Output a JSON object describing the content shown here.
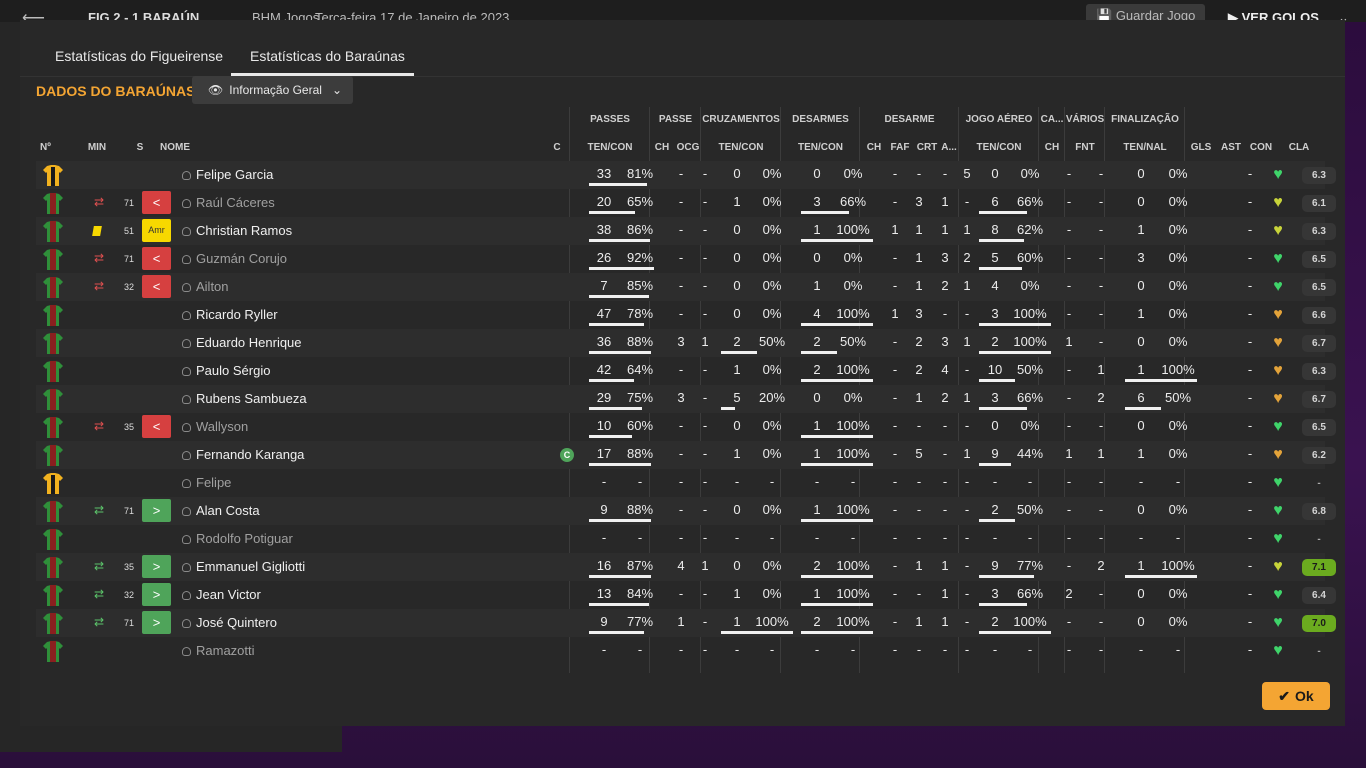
{
  "topbar": {
    "score": "FIG  2 - 1  BARAÚN",
    "org": "BHM Jogos",
    "date": "Terça-feira 17 de Janeiro de 2023",
    "save_label": "Guardar Jogo",
    "goals_label": "VER GOLOS"
  },
  "tabs": [
    "Estatísticas do Figueirense",
    "Estatísticas do Baraúnas"
  ],
  "title": "DADOS DO BARAÚNAS",
  "view_dropdown": "Informação Geral",
  "groups": {
    "passes": "PASSES",
    "passe": "PASSE",
    "cruz": "CRUZAMENTOS",
    "desarmes": "DESARMES",
    "desarme": "DESARME",
    "aereo": "JOGO AÉREO",
    "ca": "CA...",
    "varios": "VÁRIOS",
    "finalizacao": "FINALIZAÇÃO"
  },
  "headers": {
    "num": "Nº",
    "min": "MIN",
    "s": "S",
    "nome": "NOME",
    "c": "C",
    "passes": "TEN/CON",
    "passe_ch": "CH",
    "passe_ocg": "OCG",
    "cruz": "TEN/CON",
    "desarmes": "TEN/CON",
    "des_ch": "CH",
    "des_faf": "FAF",
    "des_crt": "CRT",
    "des_a": "A...",
    "aereo": "TEN/CON",
    "ca_ch": "CH",
    "var_fnt": "FNT",
    "fin": "TEN/NAL",
    "gls": "GLS",
    "ast": "AST",
    "con": "CON",
    "cla": "CLA"
  },
  "ok_label": "Ok",
  "colors": {
    "accent": "#f4a533",
    "cla_green": "#6bab1f",
    "red_card": "#d64040"
  },
  "players": [
    {
      "name": "Felipe Garcia",
      "gk": true,
      "min": "",
      "sub": "",
      "s": "",
      "dim": false,
      "captain": false,
      "p": [
        "33",
        "81%"
      ],
      "pp": [
        "-",
        "-"
      ],
      "cr": [
        "0",
        "0%"
      ],
      "de": [
        "0",
        "0%"
      ],
      "d2": [
        "-",
        "-",
        "-",
        "5"
      ],
      "ae": [
        "0",
        "0%"
      ],
      "ca": "-",
      "fnt": "-",
      "fi": [
        "0",
        "0%"
      ],
      "gls": "",
      "ast": "-",
      "heart": "#3fd46a",
      "cla": "6.3",
      "clastyle": "gray",
      "bars": {
        "p": 0.81,
        "cr": 0,
        "de": 0,
        "ae": 0,
        "fi": 0
      }
    },
    {
      "name": "Raúl Cáceres",
      "gk": false,
      "min": "71",
      "sub": "out",
      "s": "red",
      "dim": true,
      "captain": false,
      "p": [
        "20",
        "65%"
      ],
      "pp": [
        "-",
        "-"
      ],
      "cr": [
        "1",
        "0%"
      ],
      "de": [
        "3",
        "66%"
      ],
      "d2": [
        "-",
        "3",
        "1",
        "-"
      ],
      "ae": [
        "6",
        "66%"
      ],
      "ca": "-",
      "fnt": "-",
      "fi": [
        "0",
        "0%"
      ],
      "gls": "",
      "ast": "-",
      "heart": "#c8d43a",
      "cla": "6.1",
      "clastyle": "gray",
      "bars": {
        "p": 0.65,
        "cr": 0,
        "de": 0.66,
        "ae": 0.66,
        "fi": 0
      }
    },
    {
      "name": "Christian Ramos",
      "gk": false,
      "min": "51",
      "sub": "yellow",
      "s": "amr",
      "dim": false,
      "captain": false,
      "p": [
        "38",
        "86%"
      ],
      "pp": [
        "-",
        "-"
      ],
      "cr": [
        "0",
        "0%"
      ],
      "de": [
        "1",
        "100%"
      ],
      "d2": [
        "1",
        "1",
        "1",
        "1"
      ],
      "ae": [
        "8",
        "62%"
      ],
      "ca": "-",
      "fnt": "-",
      "fi": [
        "1",
        "0%"
      ],
      "gls": "",
      "ast": "-",
      "heart": "#c8d43a",
      "cla": "6.3",
      "clastyle": "gray",
      "bars": {
        "p": 0.86,
        "cr": 0,
        "de": 1,
        "ae": 0.62,
        "fi": 0
      }
    },
    {
      "name": "Guzmán Corujo",
      "gk": false,
      "min": "71",
      "sub": "out",
      "s": "red",
      "dim": true,
      "captain": false,
      "p": [
        "26",
        "92%"
      ],
      "pp": [
        "-",
        "-"
      ],
      "cr": [
        "0",
        "0%"
      ],
      "de": [
        "0",
        "0%"
      ],
      "d2": [
        "-",
        "1",
        "3",
        "2"
      ],
      "ae": [
        "5",
        "60%"
      ],
      "ca": "-",
      "fnt": "-",
      "fi": [
        "3",
        "0%"
      ],
      "gls": "",
      "ast": "-",
      "heart": "#3fd46a",
      "cla": "6.5",
      "clastyle": "gray",
      "bars": {
        "p": 0.92,
        "cr": 0,
        "de": 0,
        "ae": 0.6,
        "fi": 0
      }
    },
    {
      "name": "Ailton",
      "gk": false,
      "min": "32",
      "sub": "out",
      "s": "red",
      "dim": true,
      "captain": false,
      "p": [
        "7",
        "85%"
      ],
      "pp": [
        "-",
        "-"
      ],
      "cr": [
        "0",
        "0%"
      ],
      "de": [
        "1",
        "0%"
      ],
      "d2": [
        "-",
        "1",
        "2",
        "1"
      ],
      "ae": [
        "4",
        "0%"
      ],
      "ca": "-",
      "fnt": "-",
      "fi": [
        "0",
        "0%"
      ],
      "gls": "",
      "ast": "-",
      "heart": "#3fd46a",
      "cla": "6.5",
      "clastyle": "gray",
      "bars": {
        "p": 0.85,
        "cr": 0,
        "de": 0,
        "ae": 0,
        "fi": 0
      }
    },
    {
      "name": "Ricardo Ryller",
      "gk": false,
      "min": "",
      "sub": "",
      "s": "",
      "dim": false,
      "captain": false,
      "p": [
        "47",
        "78%"
      ],
      "pp": [
        "-",
        "-"
      ],
      "cr": [
        "0",
        "0%"
      ],
      "de": [
        "4",
        "100%"
      ],
      "d2": [
        "1",
        "3",
        "-",
        "-"
      ],
      "ae": [
        "3",
        "100%"
      ],
      "ca": "-",
      "fnt": "-",
      "fi": [
        "1",
        "0%"
      ],
      "gls": "",
      "ast": "-",
      "heart": "#e3a33a",
      "cla": "6.6",
      "clastyle": "gray",
      "bars": {
        "p": 0.78,
        "cr": 0,
        "de": 1,
        "ae": 1,
        "fi": 0
      }
    },
    {
      "name": "Eduardo Henrique",
      "gk": false,
      "min": "",
      "sub": "",
      "s": "",
      "dim": false,
      "captain": false,
      "p": [
        "36",
        "88%"
      ],
      "pp": [
        "3",
        "1"
      ],
      "cr": [
        "2",
        "50%"
      ],
      "de": [
        "2",
        "50%"
      ],
      "d2": [
        "-",
        "2",
        "3",
        "1"
      ],
      "ae": [
        "2",
        "100%"
      ],
      "ca": "1",
      "fnt": "-",
      "fi": [
        "0",
        "0%"
      ],
      "gls": "",
      "ast": "-",
      "heart": "#e3a33a",
      "cla": "6.7",
      "clastyle": "gray",
      "bars": {
        "p": 0.88,
        "cr": 0.5,
        "de": 0.5,
        "ae": 1,
        "fi": 0
      }
    },
    {
      "name": "Paulo Sérgio",
      "gk": false,
      "min": "",
      "sub": "",
      "s": "",
      "dim": false,
      "captain": false,
      "p": [
        "42",
        "64%"
      ],
      "pp": [
        "-",
        "-"
      ],
      "cr": [
        "1",
        "0%"
      ],
      "de": [
        "2",
        "100%"
      ],
      "d2": [
        "-",
        "2",
        "4",
        "-"
      ],
      "ae": [
        "10",
        "50%"
      ],
      "ca": "-",
      "fnt": "1",
      "fi": [
        "1",
        "100%"
      ],
      "gls": "",
      "ast": "-",
      "heart": "#e3a33a",
      "cla": "6.3",
      "clastyle": "gray",
      "bars": {
        "p": 0.64,
        "cr": 0,
        "de": 1,
        "ae": 0.5,
        "fi": 1
      }
    },
    {
      "name": "Rubens Sambueza",
      "gk": false,
      "min": "",
      "sub": "",
      "s": "",
      "dim": false,
      "captain": false,
      "p": [
        "29",
        "75%"
      ],
      "pp": [
        "3",
        "-"
      ],
      "cr": [
        "5",
        "20%"
      ],
      "de": [
        "0",
        "0%"
      ],
      "d2": [
        "-",
        "1",
        "2",
        "1"
      ],
      "ae": [
        "3",
        "66%"
      ],
      "ca": "-",
      "fnt": "2",
      "fi": [
        "6",
        "50%"
      ],
      "gls": "",
      "ast": "-",
      "heart": "#e3a33a",
      "cla": "6.7",
      "clastyle": "gray",
      "bars": {
        "p": 0.75,
        "cr": 0.2,
        "de": 0,
        "ae": 0.66,
        "fi": 0.5
      }
    },
    {
      "name": "Wallyson",
      "gk": false,
      "min": "35",
      "sub": "out",
      "s": "red",
      "dim": true,
      "captain": false,
      "p": [
        "10",
        "60%"
      ],
      "pp": [
        "-",
        "-"
      ],
      "cr": [
        "0",
        "0%"
      ],
      "de": [
        "1",
        "100%"
      ],
      "d2": [
        "-",
        "-",
        "-",
        "-"
      ],
      "ae": [
        "0",
        "0%"
      ],
      "ca": "-",
      "fnt": "-",
      "fi": [
        "0",
        "0%"
      ],
      "gls": "",
      "ast": "-",
      "heart": "#3fd46a",
      "cla": "6.5",
      "clastyle": "gray",
      "bars": {
        "p": 0.6,
        "cr": 0,
        "de": 1,
        "ae": 0,
        "fi": 0
      }
    },
    {
      "name": "Fernando Karanga",
      "gk": false,
      "min": "",
      "sub": "",
      "s": "",
      "dim": false,
      "captain": true,
      "p": [
        "17",
        "88%"
      ],
      "pp": [
        "-",
        "-"
      ],
      "cr": [
        "1",
        "0%"
      ],
      "de": [
        "1",
        "100%"
      ],
      "d2": [
        "-",
        "5",
        "-",
        "1"
      ],
      "ae": [
        "9",
        "44%"
      ],
      "ca": "1",
      "fnt": "1",
      "fi": [
        "1",
        "0%"
      ],
      "gls": "",
      "ast": "-",
      "heart": "#e3a33a",
      "cla": "6.2",
      "clastyle": "gray",
      "bars": {
        "p": 0.88,
        "cr": 0,
        "de": 1,
        "ae": 0.44,
        "fi": 0
      }
    },
    {
      "name": "Felipe",
      "gk": true,
      "min": "",
      "sub": "",
      "s": "",
      "dim": true,
      "captain": false,
      "p": [
        "-",
        "-"
      ],
      "pp": [
        "-",
        "-"
      ],
      "cr": [
        "-",
        "-"
      ],
      "de": [
        "-",
        "-"
      ],
      "d2": [
        "-",
        "-",
        "-",
        "-"
      ],
      "ae": [
        "-",
        "-"
      ],
      "ca": "-",
      "fnt": "-",
      "fi": [
        "-",
        "-"
      ],
      "gls": "",
      "ast": "-",
      "heart": "#3fd46a",
      "cla": "-",
      "clastyle": "none",
      "bars": {
        "p": 0,
        "cr": 0,
        "de": 0,
        "ae": 0,
        "fi": 0
      }
    },
    {
      "name": "Alan Costa",
      "gk": false,
      "min": "71",
      "sub": "in",
      "s": "green",
      "dim": false,
      "captain": false,
      "p": [
        "9",
        "88%"
      ],
      "pp": [
        "-",
        "-"
      ],
      "cr": [
        "0",
        "0%"
      ],
      "de": [
        "1",
        "100%"
      ],
      "d2": [
        "-",
        "-",
        "-",
        "-"
      ],
      "ae": [
        "2",
        "50%"
      ],
      "ca": "-",
      "fnt": "-",
      "fi": [
        "0",
        "0%"
      ],
      "gls": "",
      "ast": "-",
      "heart": "#3fd46a",
      "cla": "6.8",
      "clastyle": "gray",
      "bars": {
        "p": 0.88,
        "cr": 0,
        "de": 1,
        "ae": 0.5,
        "fi": 0
      }
    },
    {
      "name": "Rodolfo Potiguar",
      "gk": false,
      "min": "",
      "sub": "",
      "s": "",
      "dim": true,
      "captain": false,
      "p": [
        "-",
        "-"
      ],
      "pp": [
        "-",
        "-"
      ],
      "cr": [
        "-",
        "-"
      ],
      "de": [
        "-",
        "-"
      ],
      "d2": [
        "-",
        "-",
        "-",
        "-"
      ],
      "ae": [
        "-",
        "-"
      ],
      "ca": "-",
      "fnt": "-",
      "fi": [
        "-",
        "-"
      ],
      "gls": "",
      "ast": "-",
      "heart": "#3fd46a",
      "cla": "-",
      "clastyle": "none",
      "bars": {
        "p": 0,
        "cr": 0,
        "de": 0,
        "ae": 0,
        "fi": 0
      }
    },
    {
      "name": "Emmanuel Gigliotti",
      "gk": false,
      "min": "35",
      "sub": "in",
      "s": "green",
      "dim": false,
      "captain": false,
      "p": [
        "16",
        "87%"
      ],
      "pp": [
        "4",
        "1"
      ],
      "cr": [
        "0",
        "0%"
      ],
      "de": [
        "2",
        "100%"
      ],
      "d2": [
        "-",
        "1",
        "1",
        "-"
      ],
      "ae": [
        "9",
        "77%"
      ],
      "ca": "-",
      "fnt": "2",
      "fi": [
        "1",
        "100%"
      ],
      "gls": "",
      "ast": "-",
      "heart": "#c8d43a",
      "cla": "7.1",
      "clastyle": "green",
      "bars": {
        "p": 0.87,
        "cr": 0,
        "de": 1,
        "ae": 0.77,
        "fi": 1
      }
    },
    {
      "name": "Jean Victor",
      "gk": false,
      "min": "32",
      "sub": "in",
      "s": "green",
      "dim": false,
      "captain": false,
      "p": [
        "13",
        "84%"
      ],
      "pp": [
        "-",
        "-"
      ],
      "cr": [
        "1",
        "0%"
      ],
      "de": [
        "1",
        "100%"
      ],
      "d2": [
        "-",
        "-",
        "1",
        "-"
      ],
      "ae": [
        "3",
        "66%"
      ],
      "ca": "2",
      "fnt": "-",
      "fi": [
        "0",
        "0%"
      ],
      "gls": "",
      "ast": "-",
      "heart": "#3fd46a",
      "cla": "6.4",
      "clastyle": "gray",
      "bars": {
        "p": 0.84,
        "cr": 0,
        "de": 1,
        "ae": 0.66,
        "fi": 0
      }
    },
    {
      "name": "José Quintero",
      "gk": false,
      "min": "71",
      "sub": "in",
      "s": "green",
      "dim": false,
      "captain": false,
      "p": [
        "9",
        "77%"
      ],
      "pp": [
        "1",
        "-"
      ],
      "cr": [
        "1",
        "100%"
      ],
      "de": [
        "2",
        "100%"
      ],
      "d2": [
        "-",
        "1",
        "1",
        "-"
      ],
      "ae": [
        "2",
        "100%"
      ],
      "ca": "-",
      "fnt": "-",
      "fi": [
        "0",
        "0%"
      ],
      "gls": "",
      "ast": "-",
      "heart": "#3fd46a",
      "cla": "7.0",
      "clastyle": "green",
      "bars": {
        "p": 0.77,
        "cr": 1,
        "de": 1,
        "ae": 1,
        "fi": 0
      }
    },
    {
      "name": "Ramazotti",
      "gk": false,
      "min": "",
      "sub": "",
      "s": "",
      "dim": true,
      "captain": false,
      "p": [
        "-",
        "-"
      ],
      "pp": [
        "-",
        "-"
      ],
      "cr": [
        "-",
        "-"
      ],
      "de": [
        "-",
        "-"
      ],
      "d2": [
        "-",
        "-",
        "-",
        "-"
      ],
      "ae": [
        "-",
        "-"
      ],
      "ca": "-",
      "fnt": "-",
      "fi": [
        "-",
        "-"
      ],
      "gls": "",
      "ast": "-",
      "heart": "#3fd46a",
      "cla": "-",
      "clastyle": "none",
      "bars": {
        "p": 0,
        "cr": 0,
        "de": 0,
        "ae": 0,
        "fi": 0
      }
    }
  ]
}
